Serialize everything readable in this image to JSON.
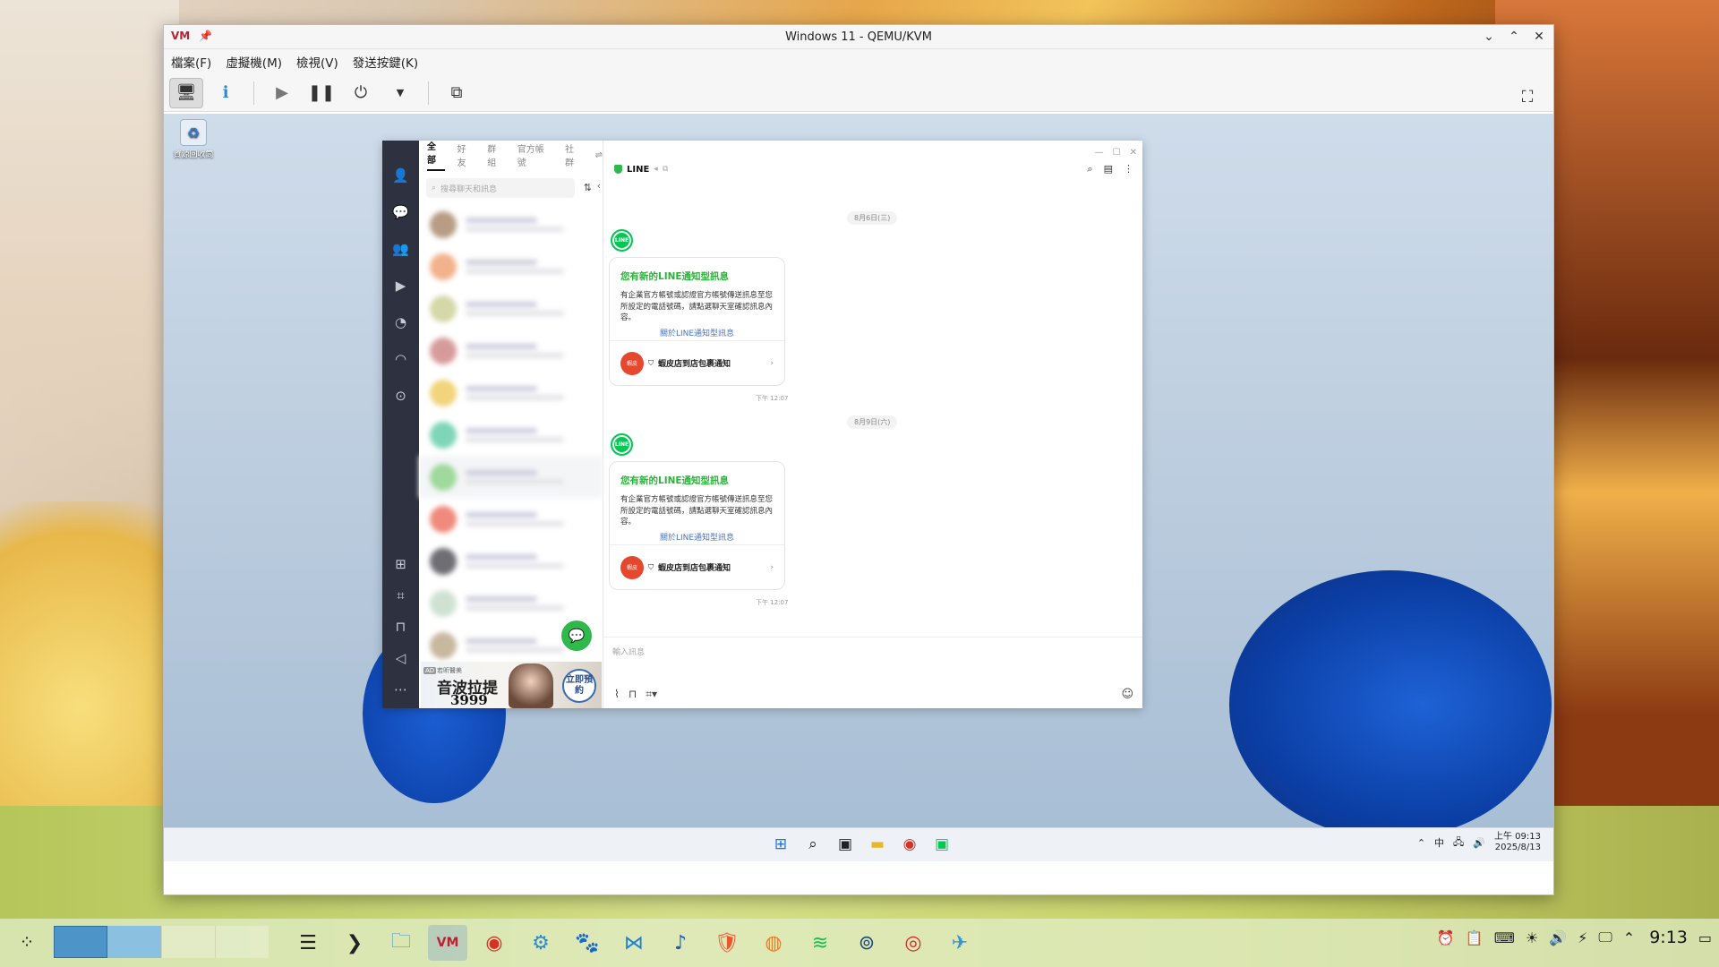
{
  "vm_window": {
    "title": "Windows 11 - QEMU/KVM",
    "menu": [
      "檔案(F)",
      "虛擬機(M)",
      "檢視(V)",
      "發送按鍵(K)"
    ]
  },
  "guest": {
    "recycle_bin_label": "資源回收筒",
    "taskbar": {
      "tray_lang": "中",
      "time": "上午 09:13",
      "date": "2025/8/13"
    }
  },
  "line": {
    "tabs": [
      "全部",
      "好友",
      "群組",
      "官方帳號",
      "社群"
    ],
    "search_placeholder": "搜尋聊天和訊息",
    "chat_name": "LINE",
    "input_placeholder": "輸入訊息",
    "messages": [
      {
        "date": "8月6日(三)",
        "title": "您有新的LINE通知型訊息",
        "body": "有企業官方帳號或認證官方帳號傳送訊息至您所設定的電話號碼，請點選聊天室確認訊息內容。",
        "link": "關於LINE通知型訊息",
        "footer": "蝦皮店到店包裹通知",
        "time": "下午 12:07"
      },
      {
        "date": "8月9日(六)",
        "title": "您有新的LINE通知型訊息",
        "body": "有企業官方帳號或認證官方帳號傳送訊息至您所設定的電話號碼，請點選聊天室確認訊息內容。",
        "link": "關於LINE通知型訊息",
        "footer": "蝦皮店到店包裹通知",
        "time": "下午 12:07"
      }
    ],
    "ad": {
      "tag": "AD",
      "brand": "若昕醫美",
      "title": "音波拉提",
      "price": "3999",
      "cta": "立即預約"
    }
  },
  "host_taskbar": {
    "clock": "9:13"
  }
}
